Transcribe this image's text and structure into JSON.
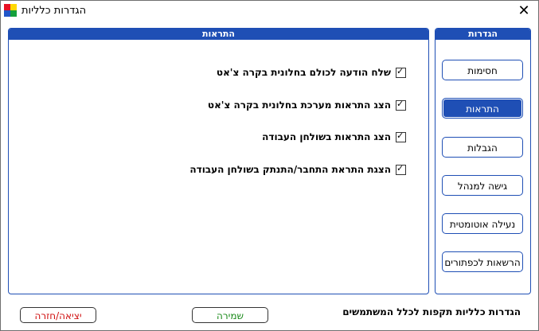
{
  "window": {
    "title": "הגדרות כלליות"
  },
  "colors": {
    "accent": "#1f4fb5",
    "save_text": "#1a8a1a",
    "exit_text": "#d01010"
  },
  "alerts_panel": {
    "header": "התראות",
    "options": [
      {
        "label": "שלח הודעה לכולם בחלונית בקרה צ'אט",
        "checked": true
      },
      {
        "label": "הצג התראות מערכת בחלונית בקרה צ'אט",
        "checked": true
      },
      {
        "label": "הצג התראות בשולחן העבודה",
        "checked": true
      },
      {
        "label": "הצגת התראת התחבר/התנתק בשולחן העבודה",
        "checked": true
      }
    ]
  },
  "settings_panel": {
    "header": "הגדרות",
    "buttons": [
      {
        "label": "חסימות"
      },
      {
        "label": "התראות",
        "active": true
      },
      {
        "label": "הגבלות"
      },
      {
        "label": "גישה למנהל"
      },
      {
        "label": "נעילה אוטומטית"
      },
      {
        "label": "הרשאות לכפתורים"
      }
    ]
  },
  "footer": {
    "note": "הגדרות כלליות תקפות לכלל המשתמשים",
    "save_label": "שמירה",
    "exit_label": "יציאה/חזרה"
  },
  "icons": {
    "app": "color-squares-icon",
    "close": "close-icon",
    "check": "checkmark-icon"
  }
}
